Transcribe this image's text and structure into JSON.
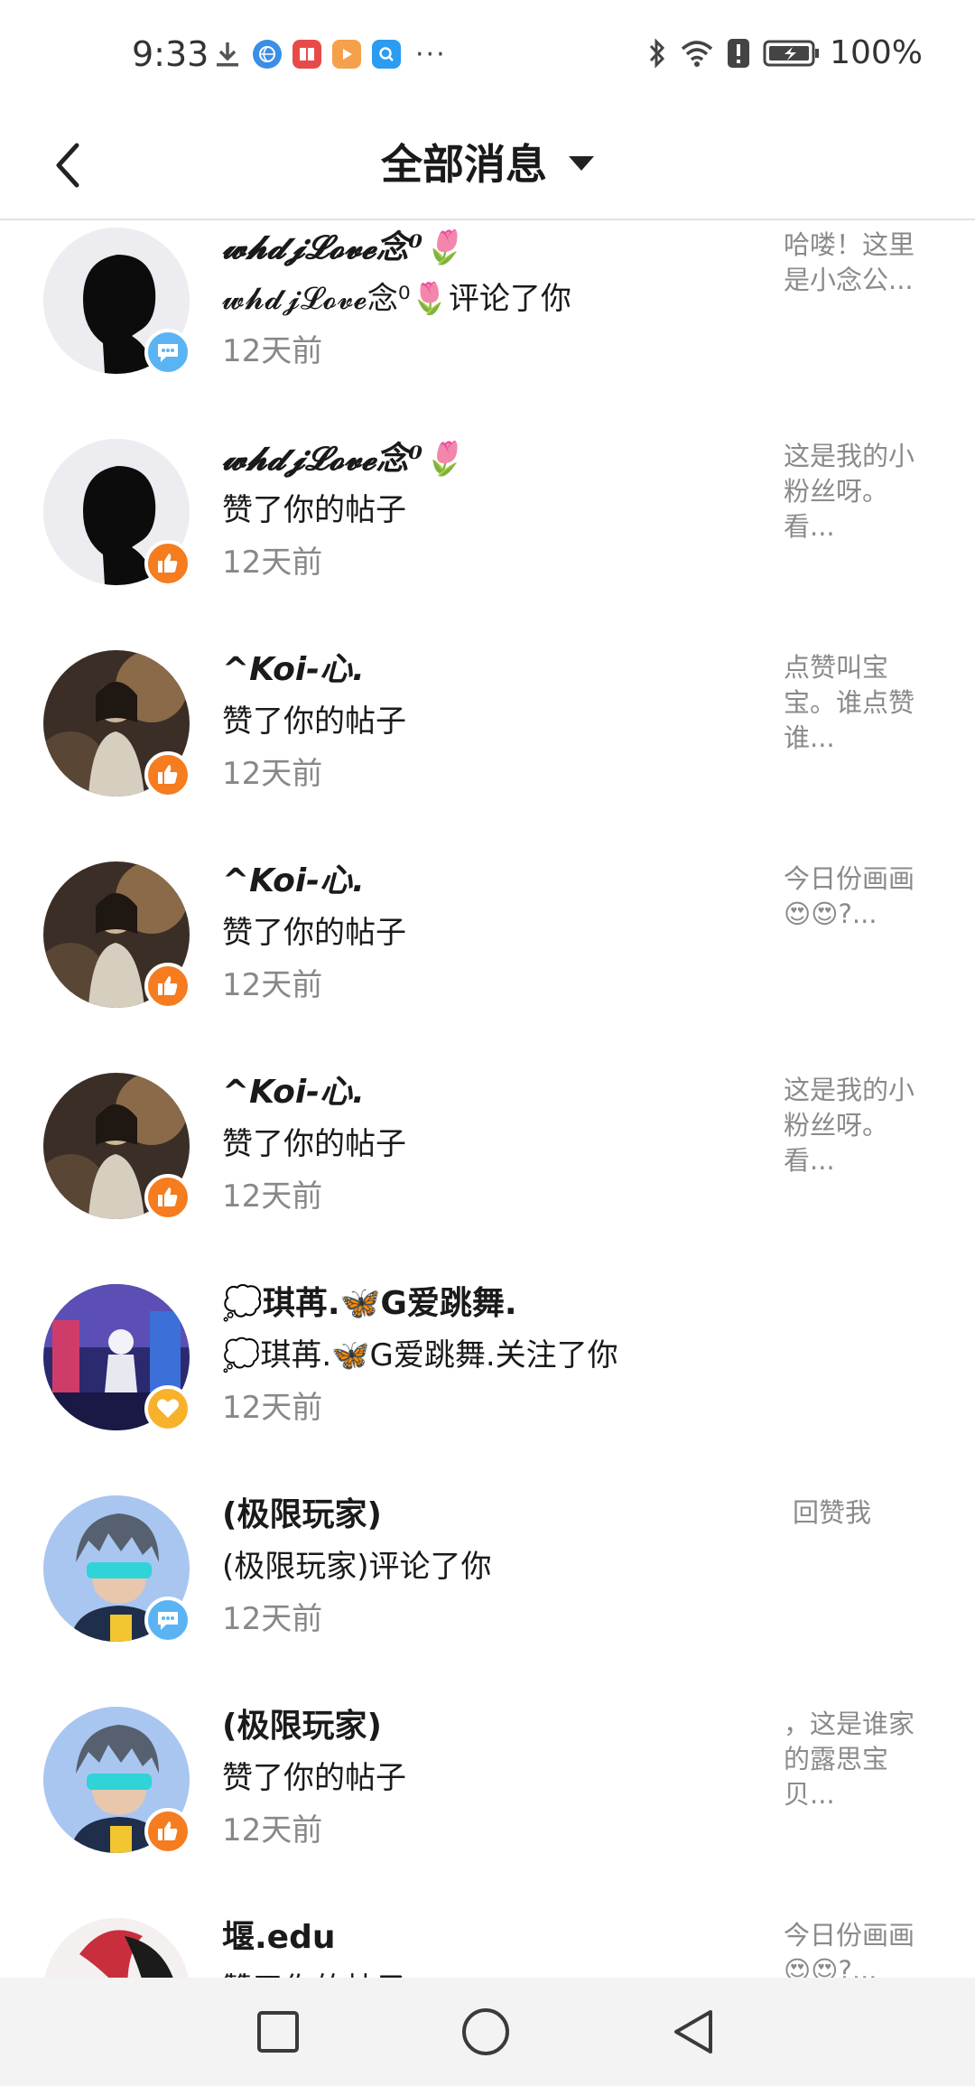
{
  "status_bar": {
    "time": "9:33",
    "more": "···",
    "battery": "100%",
    "icons": [
      "download-icon",
      "browser-app-icon",
      "reader-app-icon",
      "video-app-icon",
      "search-app-icon",
      "bluetooth-icon",
      "wifi-icon",
      "alert-icon",
      "battery-icon"
    ]
  },
  "header": {
    "title": "全部消息",
    "back_icon": "chevron-left-icon",
    "dropdown_icon": "caret-down-icon"
  },
  "colors": {
    "comment_badge": "#5ab4f4",
    "like_badge": "#f57c1f",
    "follow_badge": "#f8b12a",
    "secondary_text": "#888888"
  },
  "messages": [
    {
      "name": "𝔀𝓱𝓭𝓳𝓛𝓸𝓿𝓮念⁰🌷",
      "action": "𝔀𝓱𝓭𝓳𝓛𝓸𝓿𝓮念⁰🌷评论了你",
      "time": "12天前",
      "preview": "哈喽！这里是小念公...",
      "badge": "comment"
    },
    {
      "name": "𝔀𝓱𝓭𝓳𝓛𝓸𝓿𝓮念⁰🌷",
      "action": "赞了你的帖子",
      "time": "12天前",
      "preview": "这是我的小粉丝呀。看...",
      "badge": "like"
    },
    {
      "name": "^Koi-心.",
      "action": "赞了你的帖子",
      "time": "12天前",
      "preview": "点赞叫宝宝。谁点赞谁...",
      "badge": "like"
    },
    {
      "name": "^Koi-心.",
      "action": "赞了你的帖子",
      "time": "12天前",
      "preview": "今日份画画😍😍?...",
      "badge": "like"
    },
    {
      "name": "^Koi-心.",
      "action": "赞了你的帖子",
      "time": "12天前",
      "preview": "这是我的小粉丝呀。看...",
      "badge": "like"
    },
    {
      "name": "💭琪苒.🦋G爱跳舞.",
      "action": "💭琪苒.🦋G爱跳舞.关注了你",
      "time": "12天前",
      "preview": "",
      "badge": "follow"
    },
    {
      "name": "(极限玩家)",
      "action": "(极限玩家)评论了你",
      "time": "12天前",
      "preview": "回赞我",
      "badge": "comment"
    },
    {
      "name": "(极限玩家)",
      "action": "赞了你的帖子",
      "time": "12天前",
      "preview": "，这是谁家的露思宝贝...",
      "badge": "like"
    },
    {
      "name": "堰.edu",
      "action": "赞了你的帖子",
      "time": "",
      "preview": "今日份画画😍😍?...",
      "badge": "none"
    }
  ],
  "nav_bar": {
    "recents": "square-icon",
    "home": "circle-icon",
    "back": "triangle-back-icon"
  }
}
